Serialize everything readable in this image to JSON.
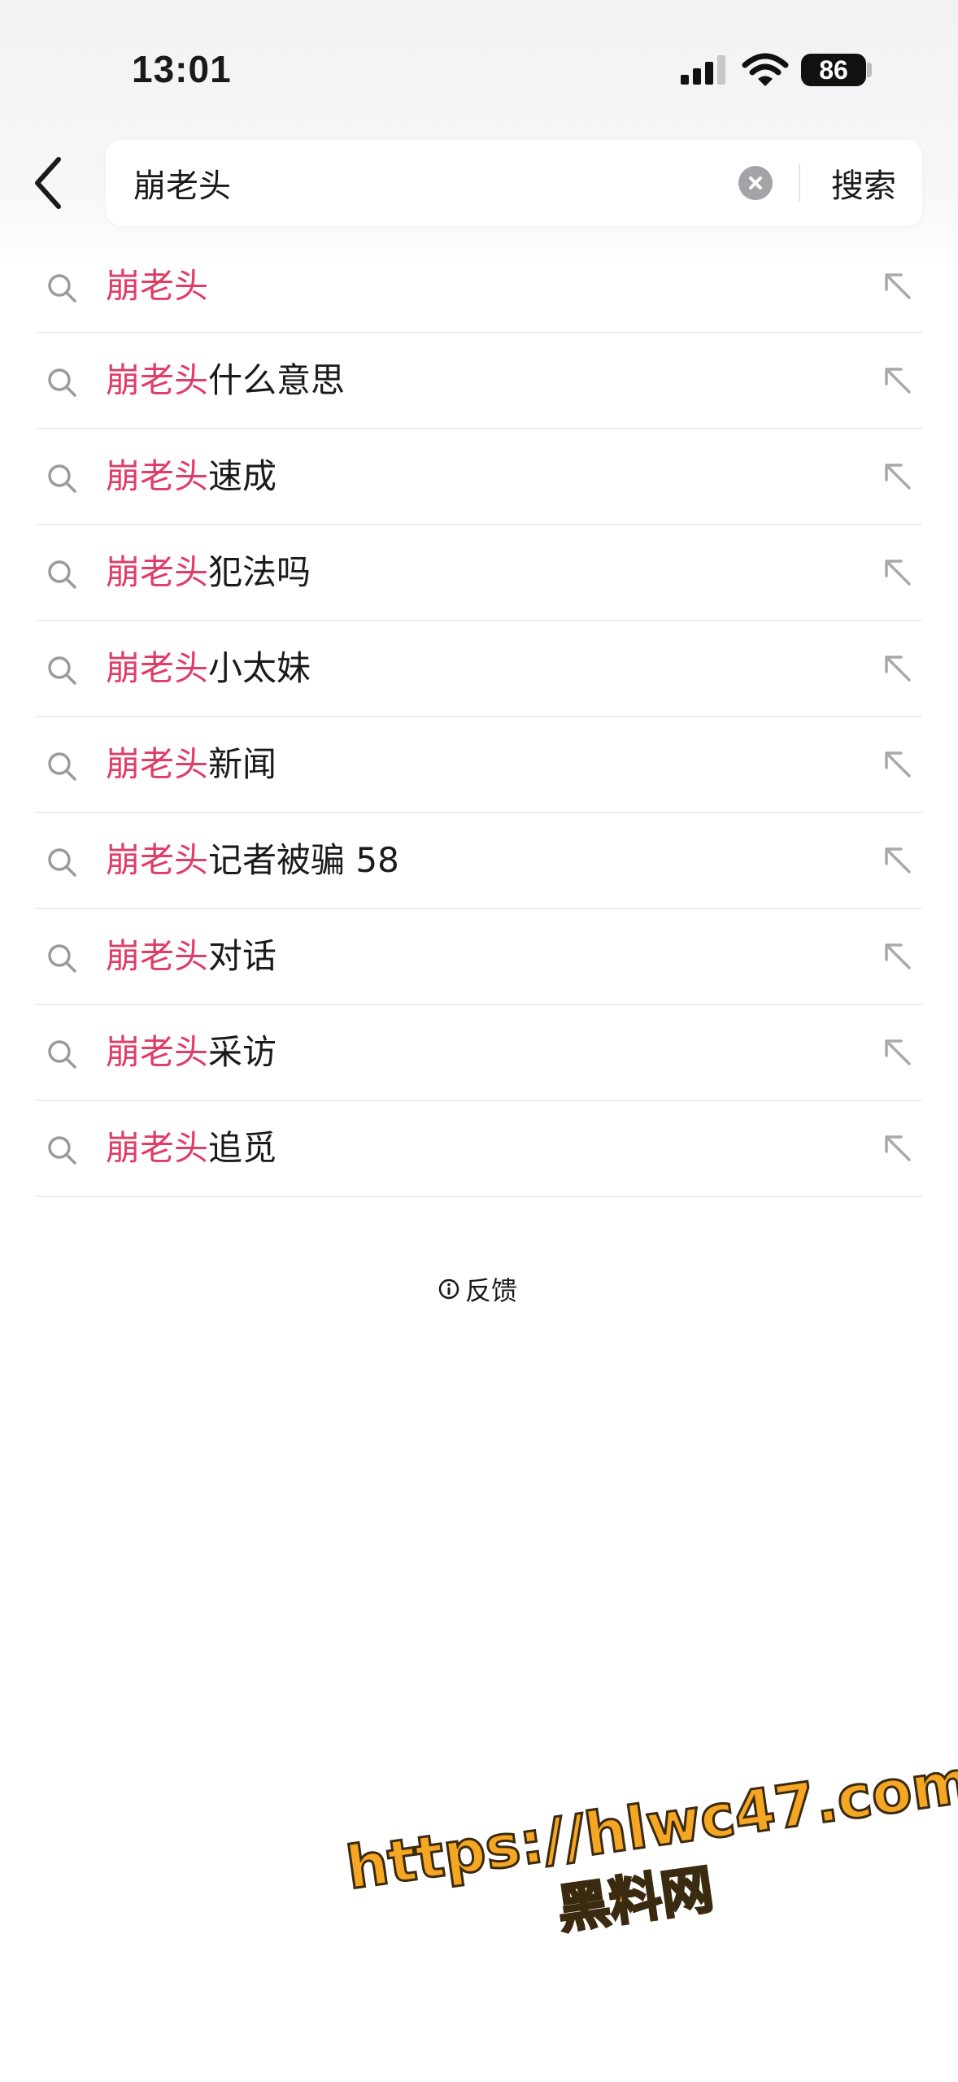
{
  "status_bar": {
    "time": "13:01",
    "battery": "86"
  },
  "search": {
    "query": "崩老头",
    "button_label": "搜索"
  },
  "suggestions": [
    {
      "highlight": "崩老头",
      "rest": ""
    },
    {
      "highlight": "崩老头",
      "rest": "什么意思"
    },
    {
      "highlight": "崩老头",
      "rest": "速成"
    },
    {
      "highlight": "崩老头",
      "rest": "犯法吗"
    },
    {
      "highlight": "崩老头",
      "rest": "小太妹"
    },
    {
      "highlight": "崩老头",
      "rest": "新闻"
    },
    {
      "highlight": "崩老头",
      "rest": "记者被骗 58"
    },
    {
      "highlight": "崩老头",
      "rest": "对话"
    },
    {
      "highlight": "崩老头",
      "rest": "采访"
    },
    {
      "highlight": "崩老头",
      "rest": "追觅"
    }
  ],
  "feedback": {
    "label": "反馈"
  },
  "watermark": {
    "url": "https://hlwc47.com",
    "text": "黑料网"
  },
  "colors": {
    "highlight": "#e03c66",
    "background": "#ffffff"
  }
}
